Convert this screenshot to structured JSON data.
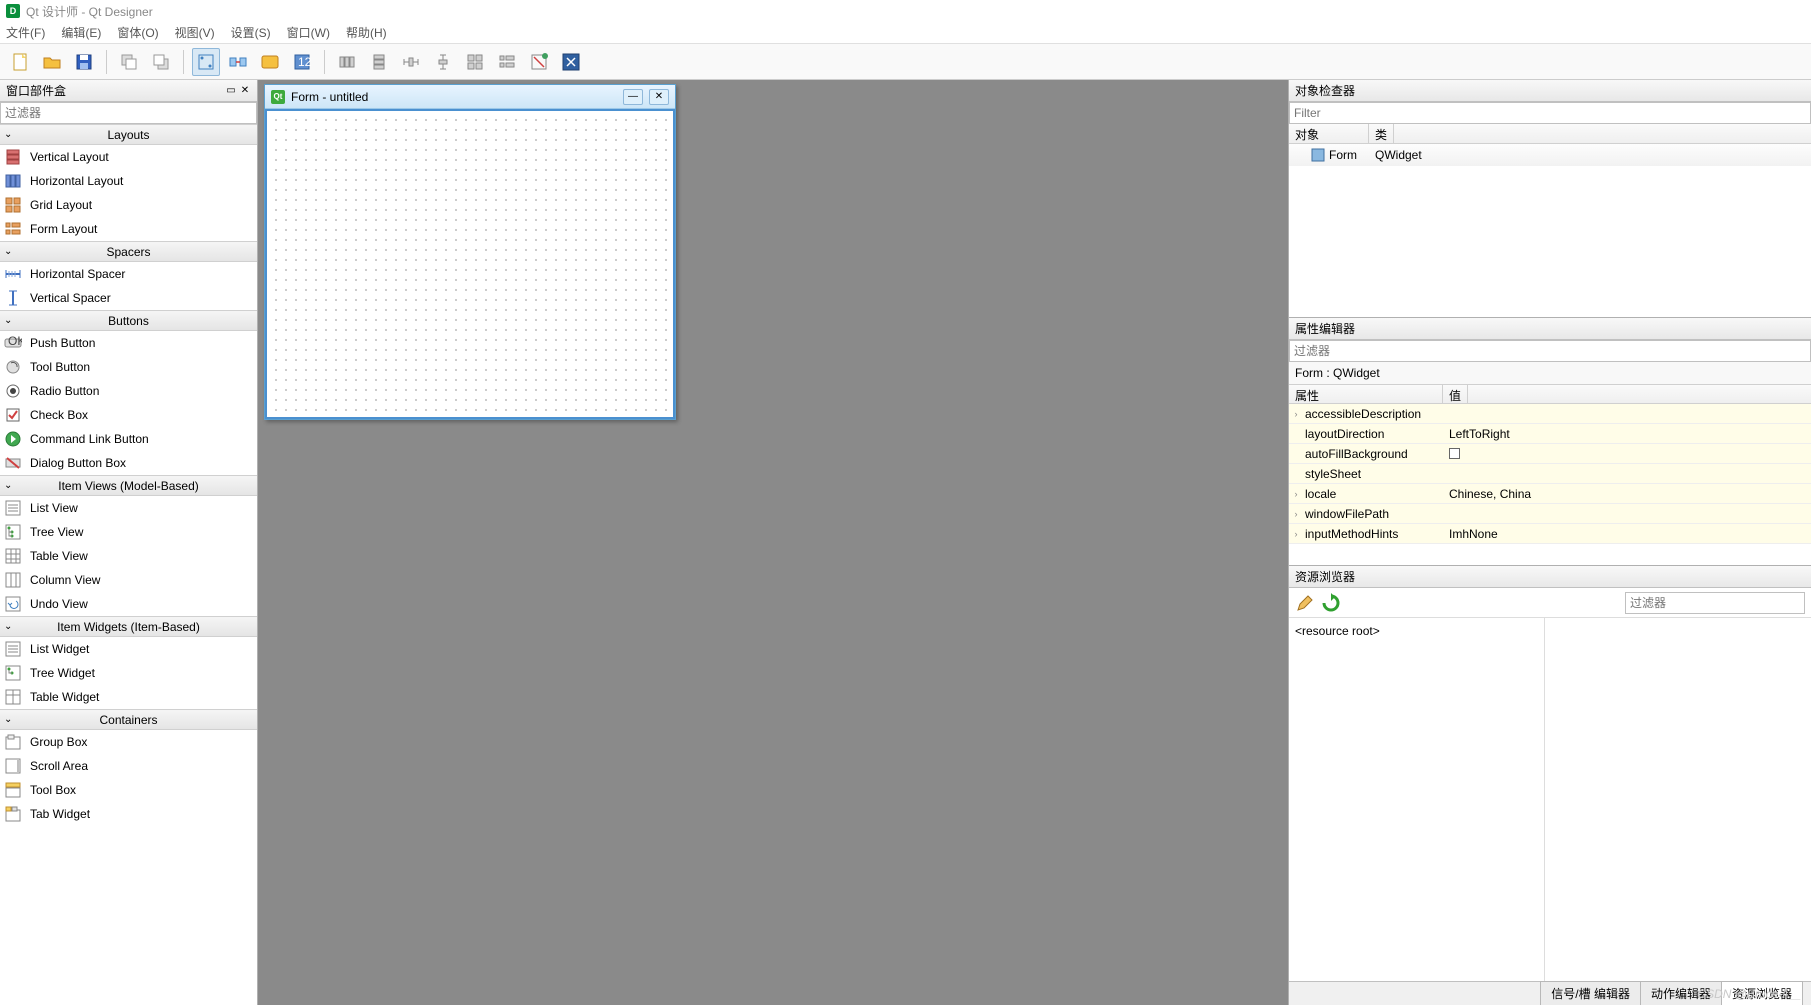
{
  "titlebar": {
    "title": "Qt 设计师 - Qt Designer"
  },
  "menu": {
    "file": "文件(F)",
    "edit": "编辑(E)",
    "form": "窗体(O)",
    "view": "视图(V)",
    "settings": "设置(S)",
    "window": "窗口(W)",
    "help": "帮助(H)"
  },
  "widgetbox": {
    "title": "窗口部件盒",
    "filter_placeholder": "过滤器",
    "categories": [
      {
        "name": "Layouts",
        "items": [
          "Vertical Layout",
          "Horizontal Layout",
          "Grid Layout",
          "Form Layout"
        ]
      },
      {
        "name": "Spacers",
        "items": [
          "Horizontal Spacer",
          "Vertical Spacer"
        ]
      },
      {
        "name": "Buttons",
        "items": [
          "Push Button",
          "Tool Button",
          "Radio Button",
          "Check Box",
          "Command Link Button",
          "Dialog Button Box"
        ]
      },
      {
        "name": "Item Views (Model-Based)",
        "items": [
          "List View",
          "Tree View",
          "Table View",
          "Column View",
          "Undo View"
        ]
      },
      {
        "name": "Item Widgets (Item-Based)",
        "items": [
          "List Widget",
          "Tree Widget",
          "Table Widget"
        ]
      },
      {
        "name": "Containers",
        "items": [
          "Group Box",
          "Scroll Area",
          "Tool Box",
          "Tab Widget"
        ]
      }
    ]
  },
  "formwin": {
    "title": "Form - untitled"
  },
  "object_inspector": {
    "title": "对象检查器",
    "filter_placeholder": "Filter",
    "cols": {
      "object": "对象",
      "class": "类"
    },
    "row": {
      "name": "Form",
      "cls": "QWidget"
    }
  },
  "property_editor": {
    "title": "属性编辑器",
    "filter_placeholder": "过滤器",
    "breadcrumb": "Form : QWidget",
    "cols": {
      "prop": "属性",
      "val": "值"
    },
    "rows": [
      {
        "expand": "›",
        "name": "accessibleDescription",
        "value": ""
      },
      {
        "expand": "",
        "name": "layoutDirection",
        "value": "LeftToRight"
      },
      {
        "expand": "",
        "name": "autoFillBackground",
        "value": "checkbox"
      },
      {
        "expand": "",
        "name": "styleSheet",
        "value": ""
      },
      {
        "expand": "›",
        "name": "locale",
        "value": "Chinese, China"
      },
      {
        "expand": "›",
        "name": "windowFilePath",
        "value": ""
      },
      {
        "expand": "›",
        "name": "inputMethodHints",
        "value": "ImhNone"
      }
    ]
  },
  "resource_browser": {
    "title": "资源浏览器",
    "filter_placeholder": "过滤器",
    "root": "<resource root>"
  },
  "bottom_tabs": {
    "signal": "信号/槽 编辑器",
    "action": "动作编辑器",
    "resource": "资源浏览器"
  },
  "watermark": "CSDN @Bruce-li__"
}
